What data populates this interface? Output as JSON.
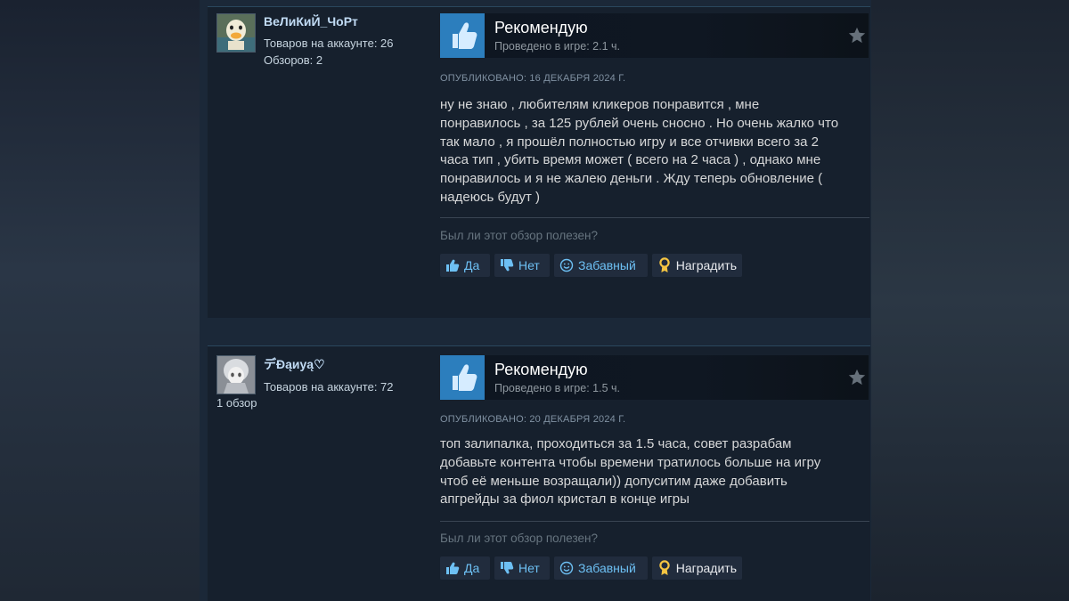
{
  "reviews": [
    {
      "username": "ВеЛиКиЙ_ЧоРт",
      "products": "Товаров на аккаунте: 26",
      "reviews_count": "Обзоров: 2",
      "verdict": "Рекомендую",
      "hours": "Проведено в игре: 2.1 ч.",
      "posted": "ОПУБЛИКОВАНО: 16 ДЕКАБРЯ 2024 Г.",
      "lines": [
        "ну не знаю , любителям кликеров понравится , мне",
        "понравилось , за 125 рублей очень сносно . Но очень жалко что",
        "так мало , я прошёл полностью игру и все отчивки всего за 2",
        "часа тип , убить время может ( всего на 2 часа ) , однако мне",
        "понравилось и я не жалею деньги . Жду теперь обновление (",
        "надеюсь будут )"
      ],
      "helpful_q": "Был ли этот обзор полезен?",
      "btn_yes": "Да",
      "btn_no": "Нет",
      "btn_funny": "Забавный",
      "btn_award": "Наградить"
    },
    {
      "username": "デÐąиуą♡",
      "products": "Товаров на аккаунте: 72",
      "reviews_count": "1 обзор",
      "verdict": "Рекомендую",
      "hours": "Проведено в игре: 1.5 ч.",
      "posted": "ОПУБЛИКОВАНО: 20 ДЕКАБРЯ 2024 Г.",
      "lines": [
        "топ залипалка, проходиться за 1.5 часа, совет разрабам",
        "добавьте контента чтобы времени тратилось больше на игру",
        "чтоб её меньше возращали)) допуситим даже добавить",
        "апгрейды за фиол кристал в конце игры"
      ],
      "helpful_q": "Был ли этот обзор полезен?",
      "btn_yes": "Да",
      "btn_no": "Нет",
      "btn_funny": "Забавный",
      "btn_award": "Наградить"
    }
  ],
  "colors": {
    "accent_blue": "#2c7ebd",
    "button_text": "#6dc0f4",
    "username": "#c1dbf4",
    "award_gold": "#f5c542"
  },
  "icons": [
    "thumbs-up-icon",
    "thumbs-down-icon",
    "smiley-icon",
    "award-ribbon-icon",
    "star-icon"
  ]
}
